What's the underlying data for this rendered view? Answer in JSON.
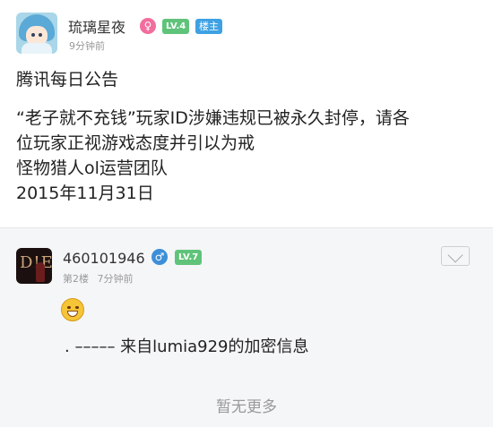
{
  "post": {
    "author": "琉璃星夜",
    "gender_symbol": "♀",
    "level": "LV.4",
    "owner_badge": "楼主",
    "time": "9分钟前",
    "title": "腾讯每日公告",
    "body_lines": [
      "“老子就不充钱”玩家ID涉嫌违规已被永久封停，请各",
      "位玩家正视游戏态度并引以为戒",
      "怪物猎人ol运营团队",
      "2015年11月31日"
    ]
  },
  "reply": {
    "author": "460101946",
    "gender_symbol": "♂",
    "level": "LV.7",
    "floor": "第2楼",
    "time": "7分钟前",
    "avatar_text": "D!E",
    "text": ". ––––– 来自lumia929的加密信息"
  },
  "footer": {
    "no_more": "暂无更多"
  },
  "colors": {
    "female": "#f26d9d",
    "male": "#3d8fd8",
    "level_badge": "#5fc37a",
    "owner_badge": "#3ea1e3"
  },
  "icons": {
    "more": "chevron-down-icon",
    "emoji": "smiley-icon"
  }
}
